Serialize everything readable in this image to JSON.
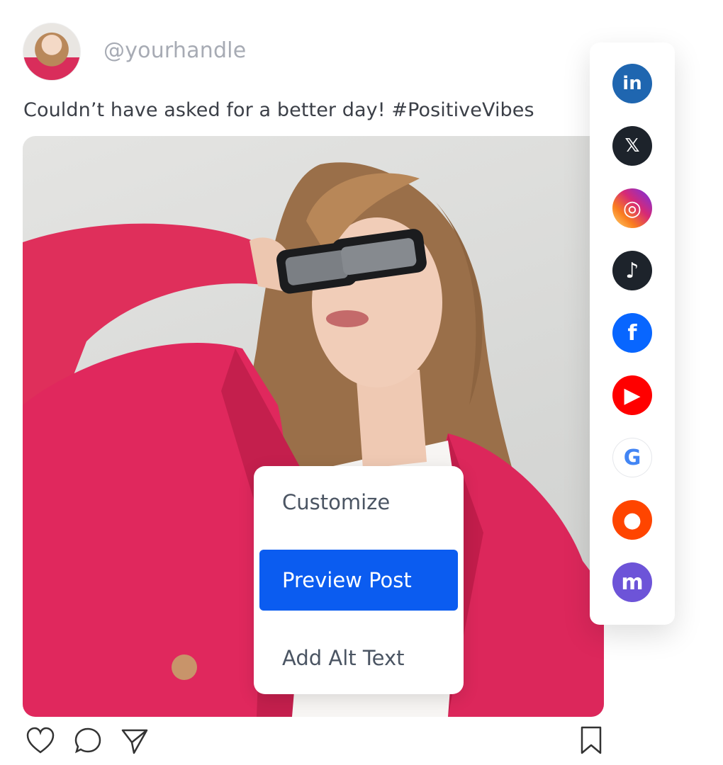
{
  "post": {
    "handle": "@yourhandle",
    "caption": "Couldn’t have asked for a better day! #PositiveVibes"
  },
  "menu": {
    "items": [
      {
        "label": "Customize",
        "active": false
      },
      {
        "label": "Preview Post",
        "active": true
      },
      {
        "label": "Add Alt Text",
        "active": false
      }
    ]
  },
  "actions": [
    "like-icon",
    "comment-icon",
    "share-icon",
    "bookmark-icon"
  ],
  "networks": [
    {
      "name": "linkedin",
      "glyph": "in",
      "color": "#1f66b0"
    },
    {
      "name": "x",
      "glyph": "𝕏",
      "color": "#1d232b"
    },
    {
      "name": "instagram",
      "glyph": "◎",
      "color": "#d6249f"
    },
    {
      "name": "tiktok",
      "glyph": "♪",
      "color": "#1d232b"
    },
    {
      "name": "facebook",
      "glyph": "f",
      "color": "#0866ff"
    },
    {
      "name": "youtube",
      "glyph": "▶",
      "color": "#ff0000"
    },
    {
      "name": "google-business",
      "glyph": "G",
      "color": "#4285f4"
    },
    {
      "name": "reddit",
      "glyph": "●",
      "color": "#ff4500"
    },
    {
      "name": "mastodon",
      "glyph": "m",
      "color": "#6d54d8"
    }
  ],
  "colors": {
    "accent": "#0b5cf0",
    "jacket": "#e0245e"
  }
}
